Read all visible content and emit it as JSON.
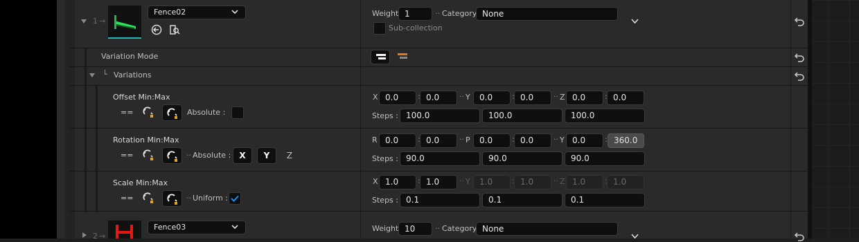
{
  "colors": {
    "accent": "#1f8ef1",
    "asset_green": "#2ee25a",
    "asset_red": "#e01818",
    "bg_dark": "#1e1e1e",
    "panel": "#2a2a2a"
  },
  "entries": [
    {
      "index": "1",
      "asset": "Fence02",
      "weight_label": "Weight",
      "weight": "1",
      "category_label": "Category",
      "category": "None",
      "subcollection_label": "Sub-collection"
    },
    {
      "index": "2",
      "asset": "Fence03",
      "weight_label": "Weight",
      "weight": "10",
      "category_label": "Category",
      "category": "None"
    }
  ],
  "variation_mode": {
    "label": "Variation Mode"
  },
  "variations": {
    "label": "Variations"
  },
  "offset": {
    "label": "Offset Min:Max",
    "link_symbol": "==",
    "absolute_label": "Absolute :",
    "axes": [
      "X",
      "Y",
      "Z"
    ],
    "values": [
      "0.0",
      "0.0",
      "0.0",
      "0.0",
      "0.0",
      "0.0"
    ],
    "steps_label": "Steps :",
    "steps": [
      "100.0",
      "100.0",
      "100.0"
    ]
  },
  "rotation": {
    "label": "Rotation Min:Max",
    "link_symbol": "==",
    "absolute_label": "Absolute :",
    "abs_axes": [
      "X",
      "Y",
      "Z"
    ],
    "axes": [
      "R",
      "P",
      "Y"
    ],
    "values": [
      "0.0",
      "0.0",
      "0.0",
      "0.0",
      "0.0",
      "360.0"
    ],
    "steps_label": "Steps :",
    "steps": [
      "90.0",
      "90.0",
      "90.0"
    ]
  },
  "scale": {
    "label": "Scale Min:Max",
    "link_symbol": "==",
    "uniform_label": "Uniform :",
    "uniform_checked": true,
    "axes": [
      "X",
      "Y",
      "Z"
    ],
    "values": [
      "1.0",
      "1.0",
      "1.0",
      "1.0",
      "1.0",
      "1.0"
    ],
    "steps_label": "Steps :",
    "steps": [
      "0.1",
      "0.1",
      "0.1"
    ]
  },
  "icons": [
    "expand-arrow-icon",
    "reset-arrow-icon",
    "browse-asset-icon",
    "use-selected-icon",
    "magnet-icon",
    "chevron-down-icon",
    "checkmark-icon"
  ]
}
